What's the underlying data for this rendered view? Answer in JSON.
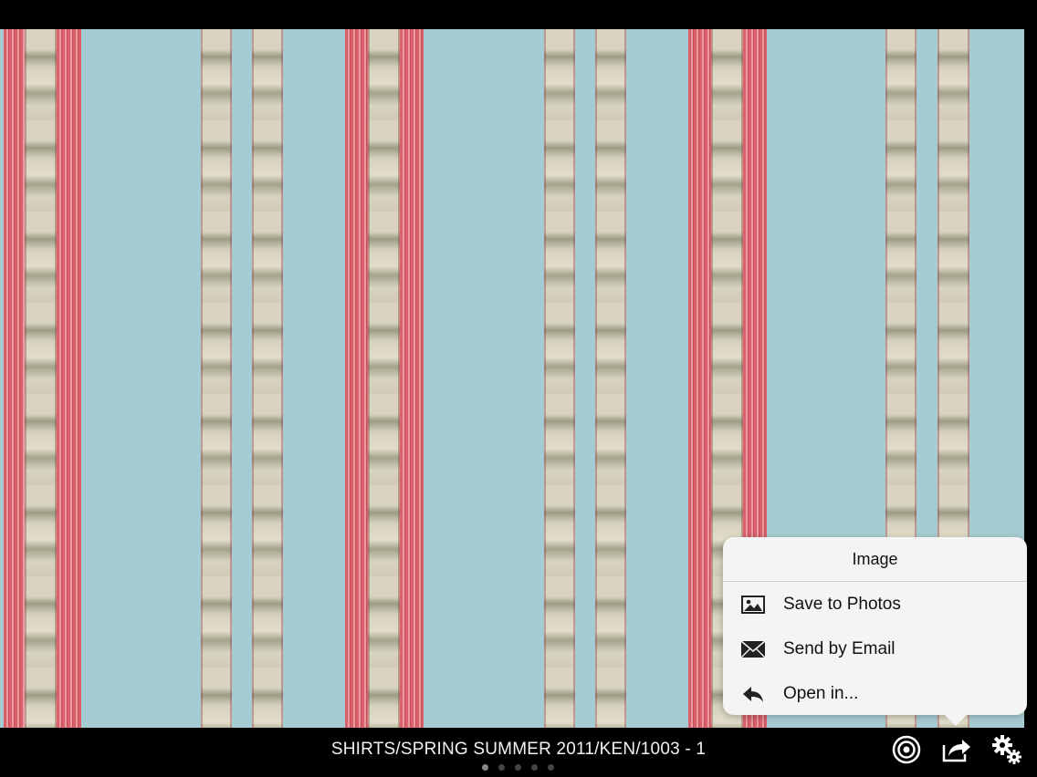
{
  "popover": {
    "title": "Image",
    "items": [
      {
        "label": "Save to Photos",
        "icon": "photo-icon"
      },
      {
        "label": "Send by Email",
        "icon": "envelope-icon"
      },
      {
        "label": "Open in...",
        "icon": "reply-arrow-icon"
      }
    ]
  },
  "footer": {
    "caption": "SHIRTS/SPRING SUMMER 2011/KEN/1003 - 1",
    "page_dots": 5,
    "active_page": 1
  },
  "toolbar": {
    "buttons": [
      {
        "icon": "target-icon"
      },
      {
        "icon": "share-icon"
      },
      {
        "icon": "gear-icon"
      }
    ]
  },
  "colors": {
    "fabric_blue": "#a6ccd3",
    "stripe_red": "#d9616b",
    "stripe_beige": "#d8d4c1",
    "popover_bg": "#f4f4f4"
  }
}
